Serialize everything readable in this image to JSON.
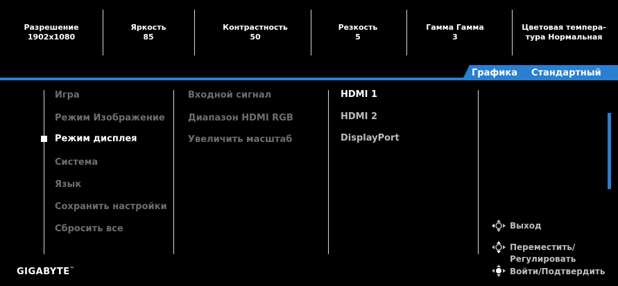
{
  "info_bar": [
    {
      "label": "Разрешение",
      "value": "1902x1080"
    },
    {
      "label": "Яркость",
      "value": "85"
    },
    {
      "label": "Контрастность",
      "value": "50"
    },
    {
      "label": "Резкость",
      "value": "5"
    },
    {
      "label": "Гамма Гамма",
      "value": "3"
    },
    {
      "label": "Цветовая темпера-",
      "value": "тура Нормальная"
    }
  ],
  "mode": {
    "tab1": "Графика",
    "tab2": "Стандартный"
  },
  "main_menu": [
    {
      "label": "Игра",
      "active": false
    },
    {
      "label": "Режим Изображение",
      "active": false
    },
    {
      "label": "Режим дисплея",
      "active": true
    },
    {
      "label": "Система",
      "active": false
    },
    {
      "label": "Язык",
      "active": false
    },
    {
      "label": "Сохранить настройки",
      "active": false
    },
    {
      "label": "Сбросить все",
      "active": false
    }
  ],
  "sub_menu": [
    {
      "label": "Входной сигнал"
    },
    {
      "label": "Диапазон HDMI RGB"
    },
    {
      "label": "Увеличить масштаб"
    }
  ],
  "options": [
    {
      "label": "HDMI 1",
      "selected": true
    },
    {
      "label": "HDMI 2",
      "selected": false
    },
    {
      "label": "DisplayPort",
      "selected": false
    }
  ],
  "hints": {
    "exit": "Выход",
    "move_line1": "Переместить/",
    "move_line2": "Регулировать",
    "enter": "Войти/Подтвердить"
  },
  "brand": "GIGABYTE",
  "colors": {
    "accent": "#2a7fd0",
    "inactive_text": "#6e6e6e",
    "background": "#000000"
  }
}
